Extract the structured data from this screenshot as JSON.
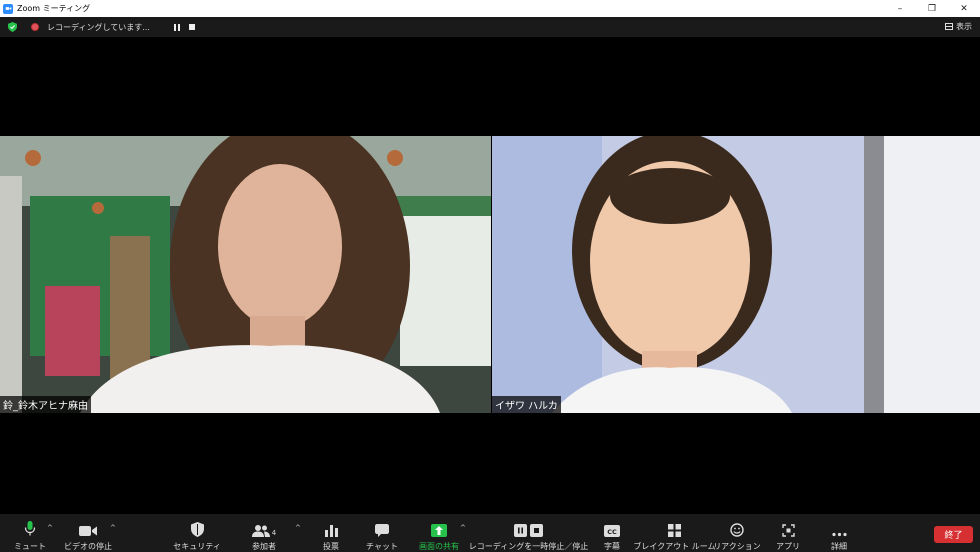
{
  "window": {
    "title": "Zoom ミーティング",
    "minimize": "–",
    "restore": "❐",
    "close": "✕"
  },
  "status": {
    "recording_text": "レコーディングしています...",
    "view_label": "表示"
  },
  "participants": [
    {
      "name": "鈴_鈴木アヒナ麻由"
    },
    {
      "name": "イザワ ハルカ"
    }
  ],
  "toolbar": {
    "mute": "ミュート",
    "stop_video": "ビデオの停止",
    "security": "セキュリティ",
    "participants": "参加者",
    "participants_count": "4",
    "polls": "投票",
    "chat": "チャット",
    "share_screen": "画面の共有",
    "recording_control": "レコーディングを一時停止／停止",
    "captions": "字幕",
    "breakout_rooms": "ブレイクアウト ルーム",
    "reactions": "リアクション",
    "apps": "アプリ",
    "more": "詳細",
    "end": "終了"
  },
  "colors": {
    "accent_share": "#27c24c",
    "end_button": "#d73033",
    "recording_dot": "#e0525c",
    "secure_shield": "#27c24c"
  }
}
